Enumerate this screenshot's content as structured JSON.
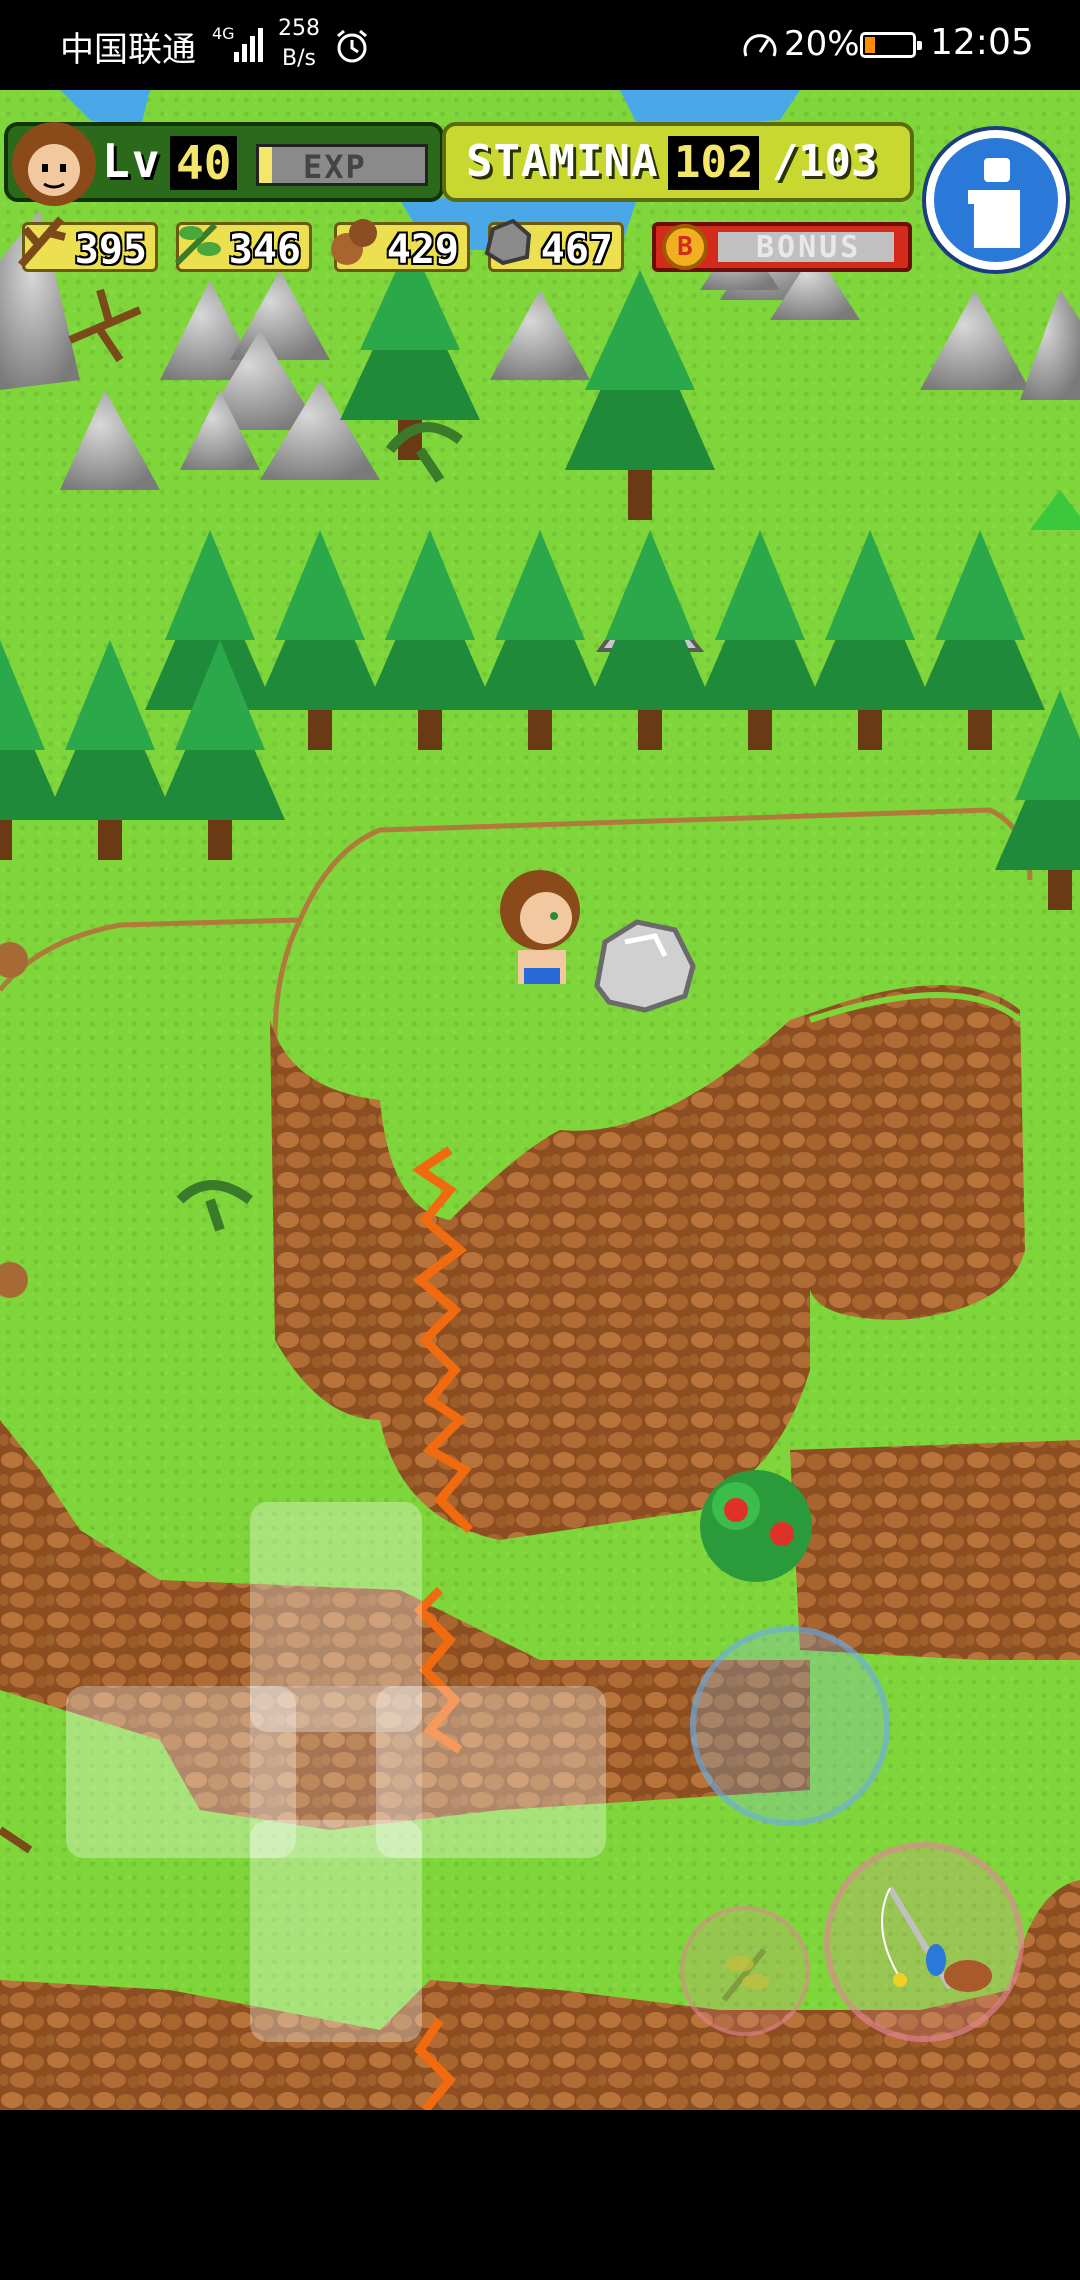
{
  "status_bar": {
    "carrier": "中国联通",
    "network": "4G",
    "net_speed_value": "258",
    "net_speed_unit": "B/s",
    "battery_percent": "20%",
    "battery_level": 0.2,
    "time": "12:05",
    "icons": [
      "signal-icon",
      "alarm-icon",
      "speedometer-icon",
      "battery-icon"
    ]
  },
  "hud": {
    "level_label": "Lv",
    "level": "40",
    "exp_label": "EXP",
    "exp_progress": 0.08,
    "stamina_label": "STAMINA",
    "stamina_current": "102",
    "stamina_separator": "/",
    "stamina_max": "103",
    "info_icon": "info-icon",
    "resources": [
      {
        "name": "branch",
        "icon": "branch-icon",
        "value": "395"
      },
      {
        "name": "herb",
        "icon": "herb-icon",
        "value": "346"
      },
      {
        "name": "nut",
        "icon": "nut-icon",
        "value": "429"
      },
      {
        "name": "stone",
        "icon": "stone-icon",
        "value": "467"
      }
    ],
    "bonus_coin": "B",
    "bonus_label": "BONUS",
    "bonus_progress": 0.0
  },
  "controls": {
    "dpad": [
      "up",
      "down",
      "left",
      "right"
    ],
    "action_button": "action-button",
    "item_button_icon": "herb-icon",
    "tool_button_icon": "fishing-rod-icon"
  },
  "colors": {
    "grass": "#7ed63a",
    "cliff": "#9a5a28",
    "tree": "#1e8a3a",
    "stamina_panel": "#c8d830",
    "level_panel": "#2b6a1a",
    "bonus_bar": "#d42a1c",
    "info_button": "#2a78d8"
  }
}
